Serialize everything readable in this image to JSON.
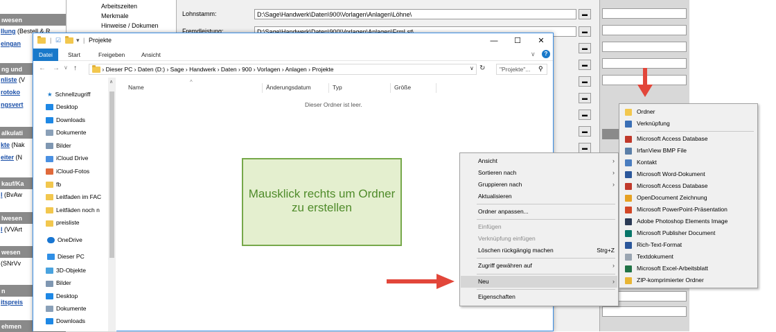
{
  "background": {
    "left_panel": {
      "headers": [
        "ıwesen",
        "ng und",
        "alkulati",
        "kauf/Ka",
        "lwesen",
        "wesen",
        "n",
        "ehmen"
      ],
      "links": [
        {
          "link": "llung",
          "rest": " (Bestell & R"
        },
        {
          "link": "eingan",
          "rest": ""
        },
        {
          "link": "nliste",
          "rest": " (V"
        },
        {
          "link": "rotoko",
          "rest": ""
        },
        {
          "link": "ngsvert",
          "rest": ""
        },
        {
          "link": "kte",
          "rest": " (Nak"
        },
        {
          "link": "eiter",
          "rest": " (N"
        },
        {
          "link": "l",
          "rest": " (BvAw"
        },
        {
          "link": "l",
          "rest": " (VVArt"
        },
        {
          "link": "",
          "rest": " (SNrVv"
        },
        {
          "link": "itspreis",
          "rest": ""
        }
      ]
    },
    "tree_items": [
      "Arbeitszeiten",
      "Merkmale",
      "Hinweise / Dokumen"
    ],
    "settings": [
      {
        "label": "Lohnstamm:",
        "value": "D:\\Sage\\Handwerk\\Daten\\900\\Vorlagen\\Anlagen\\Löhne\\"
      },
      {
        "label": "Fremdleistung:",
        "value": "D:\\Sage\\Handwerk\\Daten\\900\\Vorlagen\\Anlagen\\FrmLst\\"
      }
    ]
  },
  "explorer": {
    "title": "Projekte",
    "window_controls": {
      "minimize": "—",
      "maximize": "☐",
      "close": "✕"
    },
    "ribbon_tabs": [
      "Datei",
      "Start",
      "Freigeben",
      "Ansicht"
    ],
    "breadcrumb": [
      "Dieser PC",
      "Daten (D:)",
      "Sage",
      "Handwerk",
      "Daten",
      "900",
      "Vorlagen",
      "Anlagen",
      "Projekte"
    ],
    "search_placeholder": "\"Projekte\"...",
    "quick_access_label": "Schnellzugriff",
    "quick_access": [
      {
        "label": "Desktop",
        "icon": "desktop-icon",
        "color": "#1e88e5"
      },
      {
        "label": "Downloads",
        "icon": "download-icon",
        "color": "#1e88e5"
      },
      {
        "label": "Dokumente",
        "icon": "document-icon",
        "color": "#8aa0b8"
      },
      {
        "label": "Bilder",
        "icon": "picture-icon",
        "color": "#7f97b2"
      },
      {
        "label": "iCloud Drive",
        "icon": "cloud-icon",
        "color": "#4a90e2"
      },
      {
        "label": "iCloud-Fotos",
        "icon": "photos-icon",
        "color": "#e06a3b"
      },
      {
        "label": "fb",
        "icon": "folder-icon",
        "color": "#f2c74e"
      },
      {
        "label": "Leitfaden im FAC",
        "icon": "folder-icon",
        "color": "#f2c74e"
      },
      {
        "label": "Leitfäden noch n",
        "icon": "folder-icon",
        "color": "#f2c74e"
      },
      {
        "label": "preisliste",
        "icon": "folder-icon",
        "color": "#f2c74e"
      }
    ],
    "onedrive_label": "OneDrive",
    "this_pc_label": "Dieser PC",
    "this_pc": [
      {
        "label": "3D-Objekte",
        "icon": "cube-icon",
        "color": "#4aa3df"
      },
      {
        "label": "Bilder",
        "icon": "picture-icon",
        "color": "#7f97b2"
      },
      {
        "label": "Desktop",
        "icon": "desktop-icon",
        "color": "#1e88e5"
      },
      {
        "label": "Dokumente",
        "icon": "document-icon",
        "color": "#8aa0b8"
      },
      {
        "label": "Downloads",
        "icon": "download-icon",
        "color": "#1e88e5"
      }
    ],
    "columns": [
      "Name",
      "Änderungsdatum",
      "Typ",
      "Größe"
    ],
    "empty_text": "Dieser Ordner ist leer."
  },
  "callout_text": "Mausklick rechts um Ordner zu erstellen",
  "context_menu": {
    "items": [
      {
        "label": "Ansicht",
        "submenu": true,
        "disabled": false
      },
      {
        "label": "Sortieren nach",
        "submenu": true,
        "disabled": false
      },
      {
        "label": "Gruppieren nach",
        "submenu": true,
        "disabled": false
      },
      {
        "label": "Aktualisieren",
        "submenu": false,
        "disabled": false
      },
      {
        "label": "Ordner anpassen...",
        "submenu": false,
        "disabled": false
      },
      {
        "label": "Einfügen",
        "submenu": false,
        "disabled": true
      },
      {
        "label": "Verknüpfung einfügen",
        "submenu": false,
        "disabled": true
      },
      {
        "label": "Löschen rückgängig machen",
        "shortcut": "Strg+Z",
        "submenu": false,
        "disabled": false
      },
      {
        "label": "Zugriff gewähren auf",
        "submenu": true,
        "disabled": false
      },
      {
        "label": "Neu",
        "submenu": true,
        "disabled": false,
        "highlighted": true
      },
      {
        "label": "Eigenschaften",
        "submenu": false,
        "disabled": false
      }
    ]
  },
  "new_submenu": {
    "items": [
      {
        "label": "Ordner",
        "icon": "folder-icon",
        "color": "#f2c74e"
      },
      {
        "label": "Verknüpfung",
        "icon": "shortcut-icon",
        "color": "#3a6fb5"
      },
      {
        "label": "Microsoft Access Database",
        "icon": "access-icon",
        "color": "#c0392b"
      },
      {
        "label": "IrfanView BMP File",
        "icon": "bmp-icon",
        "color": "#5b7fa8"
      },
      {
        "label": "Kontakt",
        "icon": "contact-icon",
        "color": "#4a7dbf"
      },
      {
        "label": "Microsoft Word-Dokument",
        "icon": "word-icon",
        "color": "#2b579a"
      },
      {
        "label": "Microsoft Access Database",
        "icon": "access-icon",
        "color": "#c0392b"
      },
      {
        "label": "OpenDocument Zeichnung",
        "icon": "draw-icon",
        "color": "#e6a123"
      },
      {
        "label": "Microsoft PowerPoint-Präsentation",
        "icon": "powerpoint-icon",
        "color": "#d24726"
      },
      {
        "label": "Adobe Photoshop Elements Image",
        "icon": "photoshop-icon",
        "color": "#2b3a55"
      },
      {
        "label": "Microsoft Publisher Document",
        "icon": "publisher-icon",
        "color": "#077568"
      },
      {
        "label": "Rich-Text-Format",
        "icon": "rtf-icon",
        "color": "#2b579a"
      },
      {
        "label": "Textdokument",
        "icon": "text-icon",
        "color": "#9aa5b1"
      },
      {
        "label": "Microsoft Excel-Arbeitsblatt",
        "icon": "excel-icon",
        "color": "#217346"
      },
      {
        "label": "ZIP-komprimierter Ordner",
        "icon": "zip-icon",
        "color": "#e8b534"
      }
    ]
  }
}
